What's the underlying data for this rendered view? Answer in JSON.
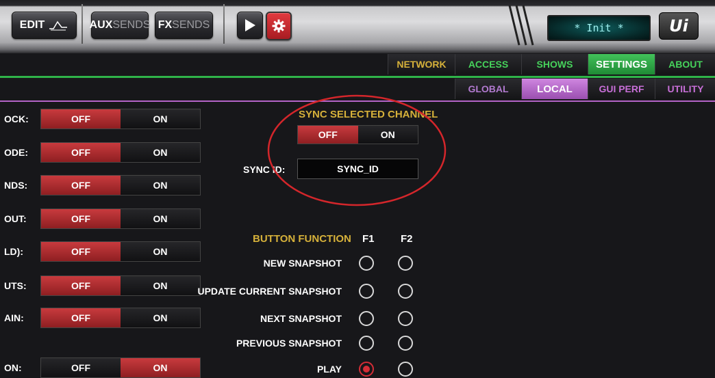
{
  "toolbar": {
    "edit_label": "EDIT",
    "aux_prefix": "AUX",
    "aux_suffix": "SENDS",
    "fx_prefix": "FX",
    "fx_suffix": "SENDS",
    "display_text": "* Init *",
    "logo_text": "Ui"
  },
  "tabs_primary": [
    {
      "label": "NETWORK",
      "color": "#d6b13a"
    },
    {
      "label": "ACCESS",
      "color": "#46d25b"
    },
    {
      "label": "SHOWS",
      "color": "#46d25b"
    },
    {
      "label": "SETTINGS",
      "active": true
    },
    {
      "label": "ABOUT",
      "color": "#46d25b"
    }
  ],
  "tabs_secondary": [
    {
      "label": "GLOBAL",
      "color": "#b27ad0"
    },
    {
      "label": "LOCAL",
      "active": true
    },
    {
      "label": "GUI PERF",
      "color": "#c86fd8"
    },
    {
      "label": "UTILITY",
      "color": "#c86fd8"
    }
  ],
  "settings_rows": [
    {
      "label": "OCK:",
      "off": "OFF",
      "on": "ON",
      "state": "off"
    },
    {
      "label": "ODE:",
      "off": "OFF",
      "on": "ON",
      "state": "off"
    },
    {
      "label": "NDS:",
      "off": "OFF",
      "on": "ON",
      "state": "off"
    },
    {
      "label": "OUT:",
      "off": "OFF",
      "on": "ON",
      "state": "off"
    },
    {
      "label": "LD):",
      "off": "OFF",
      "on": "ON",
      "state": "off"
    },
    {
      "label": "UTS:",
      "off": "OFF",
      "on": "ON",
      "state": "off"
    },
    {
      "label": "AIN:",
      "off": "OFF",
      "on": "ON",
      "state": "off"
    },
    {
      "label": "ON:",
      "off": "OFF",
      "on": "ON",
      "state": "on"
    }
  ],
  "sync": {
    "title": "SYNC SELECTED CHANNEL",
    "off": "OFF",
    "on": "ON",
    "state": "off",
    "id_label": "SYNC ID:",
    "id_value": "SYNC_ID"
  },
  "button_function": {
    "title": "BUTTON FUNCTION",
    "col1": "F1",
    "col2": "F2",
    "rows": [
      {
        "label": "NEW SNAPSHOT",
        "f1": false,
        "f2": false
      },
      {
        "label": "UPDATE CURRENT SNAPSHOT",
        "f1": false,
        "f2": false
      },
      {
        "label": "NEXT SNAPSHOT",
        "f1": false,
        "f2": false
      },
      {
        "label": "PREVIOUS SNAPSHOT",
        "f1": false,
        "f2": false
      },
      {
        "label": "PLAY",
        "f1": true,
        "f2": false
      }
    ]
  },
  "colors": {
    "accent_red": "#c83a3e",
    "accent_green": "#2fb449",
    "accent_purple": "#b564c8",
    "heading_yellow": "#d6b13a",
    "annotation_circle": "#d4262b"
  }
}
